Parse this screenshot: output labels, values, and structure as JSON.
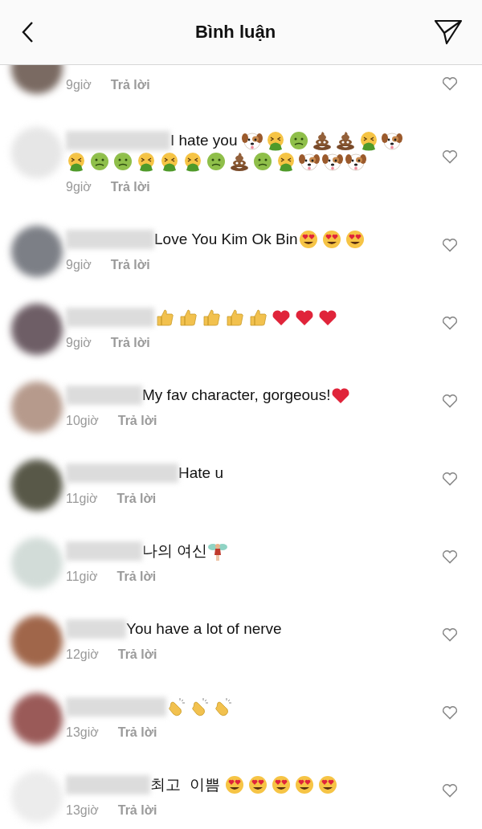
{
  "header": {
    "title": "Bình luận"
  },
  "comments": [
    {
      "color": "#7a6a62",
      "time": "9giờ",
      "reply": "Trả lời"
    },
    {
      "color": "#e6e6e6",
      "parts": [
        {
          "kind": "text",
          "text": "I hate you "
        },
        {
          "kind": "dog"
        },
        {
          "kind": "vomit"
        },
        {
          "kind": "sick"
        },
        {
          "kind": "poo"
        },
        {
          "kind": "poo"
        },
        {
          "kind": "vomit"
        },
        {
          "kind": "dog"
        },
        {
          "kind": "vomit"
        },
        {
          "kind": "sick"
        },
        {
          "kind": "sick"
        },
        {
          "kind": "vomit"
        },
        {
          "kind": "vomit"
        },
        {
          "kind": "vomit"
        },
        {
          "kind": "sick"
        },
        {
          "kind": "poo"
        },
        {
          "kind": "sick"
        },
        {
          "kind": "vomit"
        },
        {
          "kind": "dog"
        },
        {
          "kind": "dog"
        },
        {
          "kind": "dog"
        }
      ],
      "time": "9giờ",
      "reply": "Trả lời"
    },
    {
      "color": "#7c7f86",
      "parts": [
        {
          "kind": "text",
          "text": "Love You Kim Ok Bin"
        },
        {
          "kind": "hearteyes"
        },
        {
          "kind": "hearteyes"
        },
        {
          "kind": "hearteyes"
        }
      ],
      "time": "9giờ",
      "reply": "Trả lời"
    },
    {
      "color": "#6e5e66",
      "parts": [
        {
          "kind": "thumb"
        },
        {
          "kind": "thumb"
        },
        {
          "kind": "thumb"
        },
        {
          "kind": "thumb"
        },
        {
          "kind": "thumb"
        },
        {
          "kind": "heart"
        },
        {
          "kind": "heart"
        },
        {
          "kind": "heart"
        }
      ],
      "time": "9giờ",
      "reply": "Trả lời"
    },
    {
      "color": "#b69a8c",
      "parts": [
        {
          "kind": "text",
          "text": "My fav character, gorgeous!"
        },
        {
          "kind": "heart"
        }
      ],
      "time": "10giờ",
      "reply": "Trả lời"
    },
    {
      "color": "#585848",
      "parts": [
        {
          "kind": "text",
          "text": "Hate u"
        }
      ],
      "time": "11giờ",
      "reply": "Trả lời"
    },
    {
      "color": "#d2dcd8",
      "parts": [
        {
          "kind": "text",
          "text": "나의 여신"
        },
        {
          "kind": "fairy"
        }
      ],
      "time": "11giờ",
      "reply": "Trả lời"
    },
    {
      "color": "#a0664a",
      "parts": [
        {
          "kind": "text",
          "text": "You have a lot of nerve"
        }
      ],
      "time": "12giờ",
      "reply": "Trả lời"
    },
    {
      "color": "#9a5a58",
      "parts": [
        {
          "kind": "clap"
        },
        {
          "kind": "clap"
        },
        {
          "kind": "clap"
        }
      ],
      "time": "13giờ",
      "reply": "Trả lời"
    },
    {
      "color": "#ececec",
      "parts": [
        {
          "kind": "text",
          "text": "최고  이쁨 "
        },
        {
          "kind": "hearteyes"
        },
        {
          "kind": "hearteyes"
        },
        {
          "kind": "hearteyes"
        },
        {
          "kind": "hearteyes"
        },
        {
          "kind": "hearteyes"
        }
      ],
      "time": "13giờ",
      "reply": "Trả lời"
    }
  ]
}
